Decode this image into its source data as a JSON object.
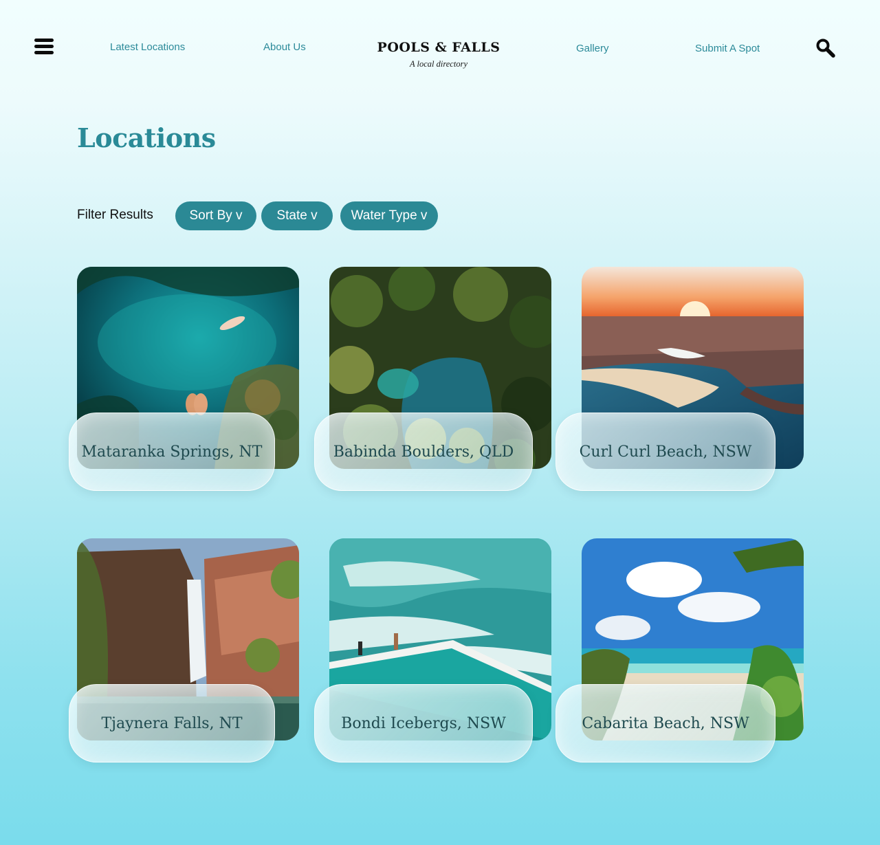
{
  "header": {
    "nav_left": [
      "Latest Locations",
      "About Us"
    ],
    "nav_right": [
      "Gallery",
      "Submit A Spot"
    ],
    "logo_title": "POOLS & FALLS",
    "logo_tagline": "A local directory",
    "menu_icon": "hamburger-menu-icon",
    "search_icon": "magnifying-glass-icon"
  },
  "page": {
    "title": "Locations",
    "filter_label": "Filter Results",
    "filters": [
      "Sort By v",
      "State v",
      "Water Type v"
    ]
  },
  "locations": [
    {
      "name": "Mataranka Springs, NT"
    },
    {
      "name": "Babinda Boulders, QLD"
    },
    {
      "name": "Curl Curl Beach, NSW"
    },
    {
      "name": "Tjaynera Falls, NT"
    },
    {
      "name": "Bondi Icebergs, NSW"
    },
    {
      "name": "Cabarita Beach, NSW"
    }
  ],
  "colors": {
    "accent": "#2b8995",
    "heading": "#2a8a97",
    "nav_text": "#2b8a99",
    "card_label_text": "#1f4a4f"
  }
}
